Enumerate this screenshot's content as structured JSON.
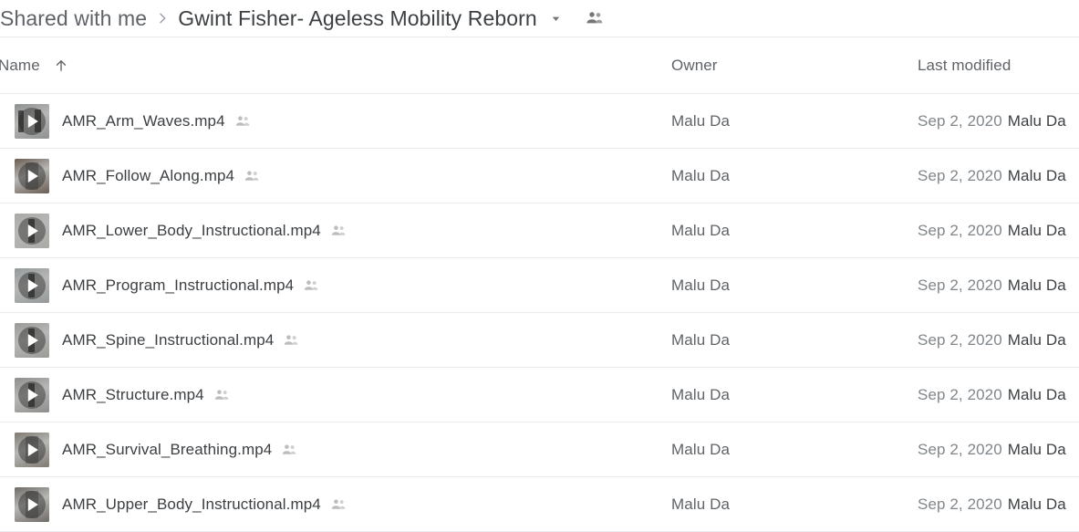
{
  "breadcrumb": {
    "root_label": "Shared with me",
    "separator_icon": "chevron-right-icon",
    "current_label": "Gwint Fisher- Ageless Mobility Reborn",
    "caret_icon": "chevron-down-icon",
    "people_icon": "people-shared-icon"
  },
  "columns": {
    "name": "Name",
    "sort_icon": "arrow-up-icon",
    "owner": "Owner",
    "last_modified": "Last modified"
  },
  "colors": {
    "text_primary": "#3c4043",
    "text_secondary": "#5f6368",
    "text_muted": "#80868b",
    "divider": "#e8eaed",
    "background": "#ffffff"
  },
  "files": [
    {
      "name": "AMR_Arm_Waves.mp4",
      "shared_icon": "people-shared-icon",
      "file_icon": "video-play-thumbnail",
      "owner": "Malu Da",
      "modified_date": "Sep 2, 2020",
      "modified_by": "Malu Da",
      "thumb_bg": "#8f9091",
      "thumb_style": "two-people"
    },
    {
      "name": "AMR_Follow_Along.mp4",
      "shared_icon": "people-shared-icon",
      "file_icon": "video-play-thumbnail",
      "owner": "Malu Da",
      "modified_date": "Sep 2, 2020",
      "modified_by": "Malu Da",
      "thumb_bg": "#6b5d52",
      "thumb_style": "dark"
    },
    {
      "name": "AMR_Lower_Body_Instructional.mp4",
      "shared_icon": "people-shared-icon",
      "file_icon": "video-play-thumbnail",
      "owner": "Malu Da",
      "modified_date": "Sep 2, 2020",
      "modified_by": "Malu Da",
      "thumb_bg": "#a9a9a6",
      "thumb_style": "one-person"
    },
    {
      "name": "AMR_Program_Instructional.mp4",
      "shared_icon": "people-shared-icon",
      "file_icon": "video-play-thumbnail",
      "owner": "Malu Da",
      "modified_date": "Sep 2, 2020",
      "modified_by": "Malu Da",
      "thumb_bg": "#94999b",
      "thumb_style": "one-person"
    },
    {
      "name": "AMR_Spine_Instructional.mp4",
      "shared_icon": "people-shared-icon",
      "file_icon": "video-play-thumbnail",
      "owner": "Malu Da",
      "modified_date": "Sep 2, 2020",
      "modified_by": "Malu Da",
      "thumb_bg": "#9a9b97",
      "thumb_style": "one-person"
    },
    {
      "name": "AMR_Structure.mp4",
      "shared_icon": "people-shared-icon",
      "file_icon": "video-play-thumbnail",
      "owner": "Malu Da",
      "modified_date": "Sep 2, 2020",
      "modified_by": "Malu Da",
      "thumb_bg": "#8d8f8c",
      "thumb_style": "one-person"
    },
    {
      "name": "AMR_Survival_Breathing.mp4",
      "shared_icon": "people-shared-icon",
      "file_icon": "video-play-thumbnail",
      "owner": "Malu Da",
      "modified_date": "Sep 2, 2020",
      "modified_by": "Malu Da",
      "thumb_bg": "#7f7a72",
      "thumb_style": "dark"
    },
    {
      "name": "AMR_Upper_Body_Instructional.mp4",
      "shared_icon": "people-shared-icon",
      "file_icon": "video-play-thumbnail",
      "owner": "Malu Da",
      "modified_date": "Sep 2, 2020",
      "modified_by": "Malu Da",
      "thumb_bg": "#6f6b66",
      "thumb_style": "dark"
    }
  ]
}
